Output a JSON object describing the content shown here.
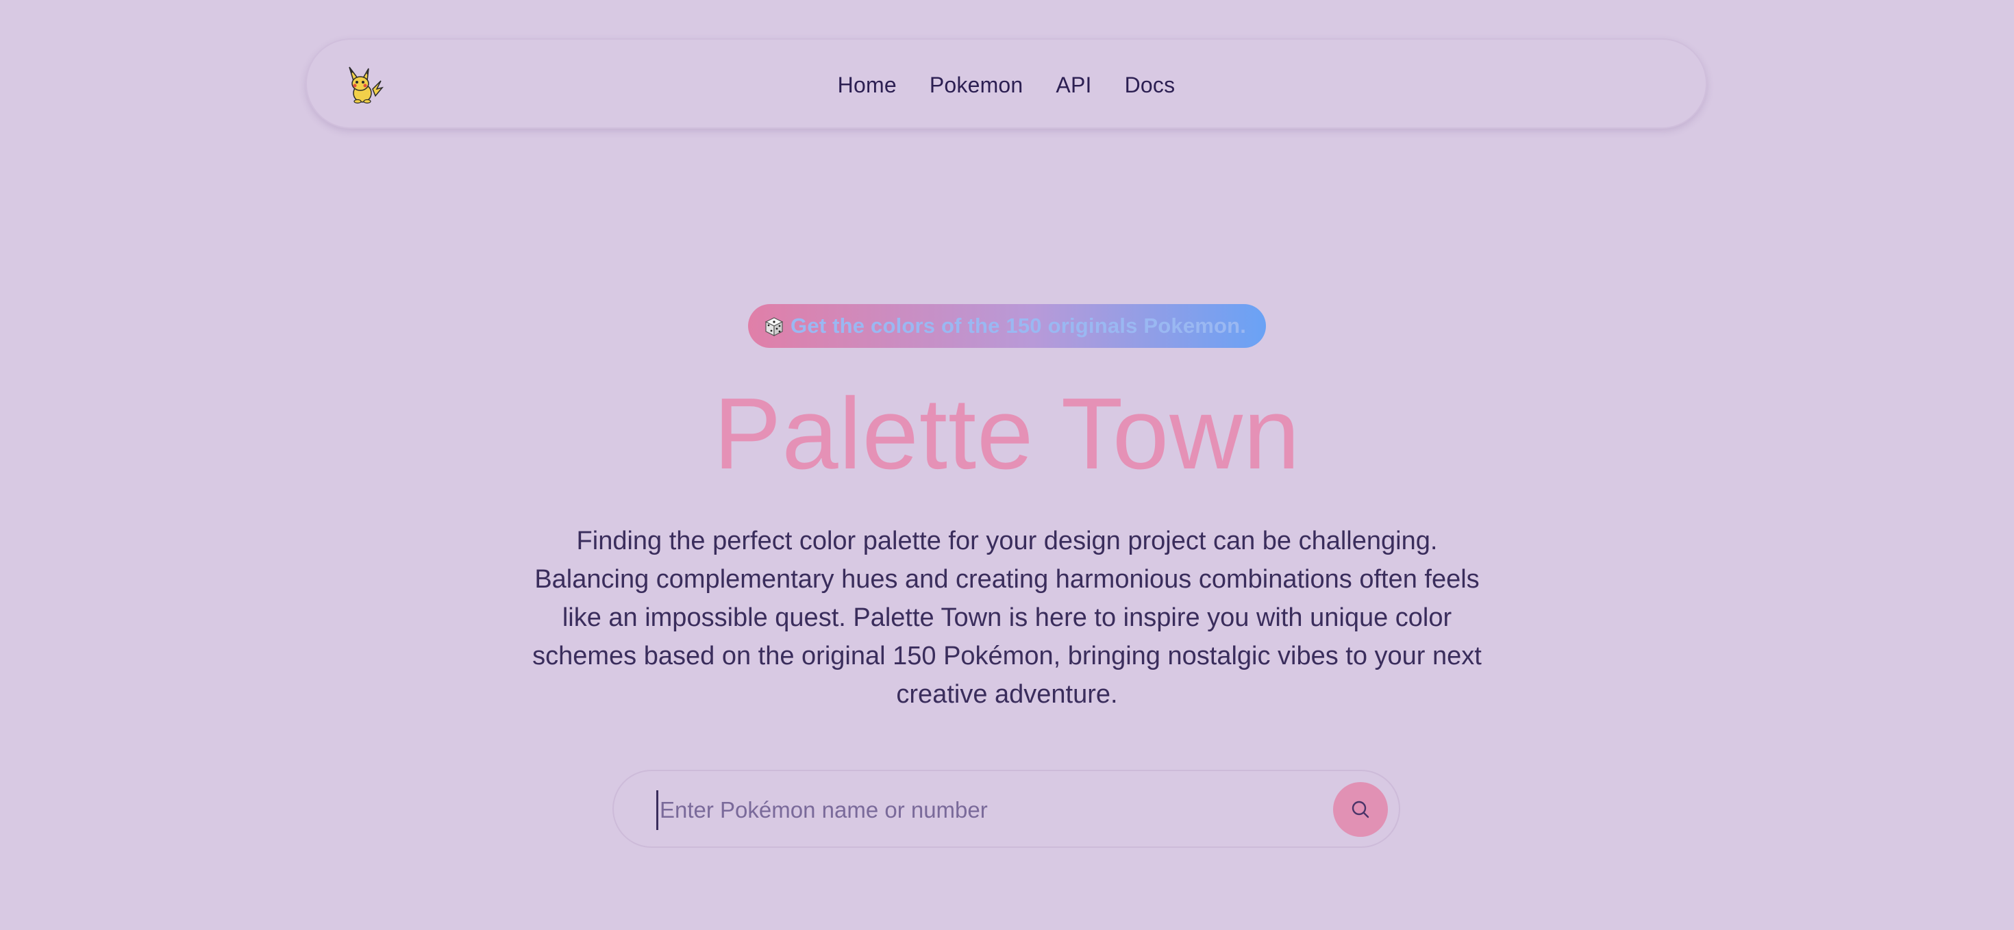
{
  "nav": {
    "logo_icon": "pikachu-icon",
    "links": [
      "Home",
      "Pokemon",
      "API",
      "Docs"
    ]
  },
  "hero": {
    "badge_icon": "dice-icon",
    "badge_text": "Get the colors of the 150 originals Pokemon.",
    "title": "Palette Town",
    "description": "Finding the perfect color palette for your design project can be challenging. Balancing complementary hues and creating harmonious combinations often feels like an impossible quest. Palette Town is here to inspire you with unique color schemes based on the original 150 Pokémon, bringing nostalgic vibes to your next creative adventure."
  },
  "search": {
    "placeholder": "Enter Pokémon name or number",
    "value": "",
    "button_icon": "search-icon"
  },
  "colors": {
    "background": "#d8c9e3",
    "title": "#e591b6",
    "text": "#3a2d5c",
    "badge_gradient_start": "#e07fa8",
    "badge_gradient_end": "#6aa2f5",
    "accent": "#e191b4"
  }
}
